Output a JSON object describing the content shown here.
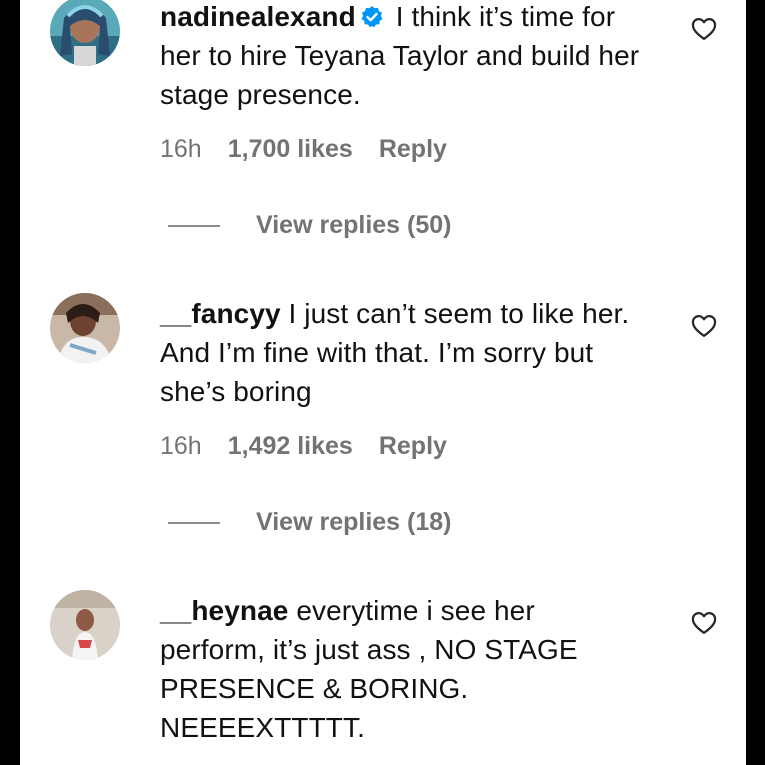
{
  "comments": [
    {
      "username": "nadinealexand",
      "verified": true,
      "text": " I think it’s time for her to hire Teyana Taylor and build her stage presence.",
      "time": "16h",
      "likes": "1,700 likes",
      "reply_label": "Reply",
      "view_replies": "View replies (50)"
    },
    {
      "username": "__fancyy",
      "verified": false,
      "text": " I just can’t seem to like her. And I’m fine with that. I’m sorry but she’s boring",
      "time": "16h",
      "likes": "1,492 likes",
      "reply_label": "Reply",
      "view_replies": "View replies (18)"
    },
    {
      "username": "__heynae",
      "verified": false,
      "text": " everytime i see her perform, it’s just ass , NO STAGE PRESENCE & BORING. NEEEEXTTTTT."
    }
  ],
  "colors": {
    "text": "#111111",
    "muted": "#737373",
    "verified_badge": "#0095f6",
    "background": "#ffffff",
    "frame": "#000000"
  },
  "icons": {
    "like": "heart-outline-icon",
    "verified": "verified-badge-icon"
  }
}
